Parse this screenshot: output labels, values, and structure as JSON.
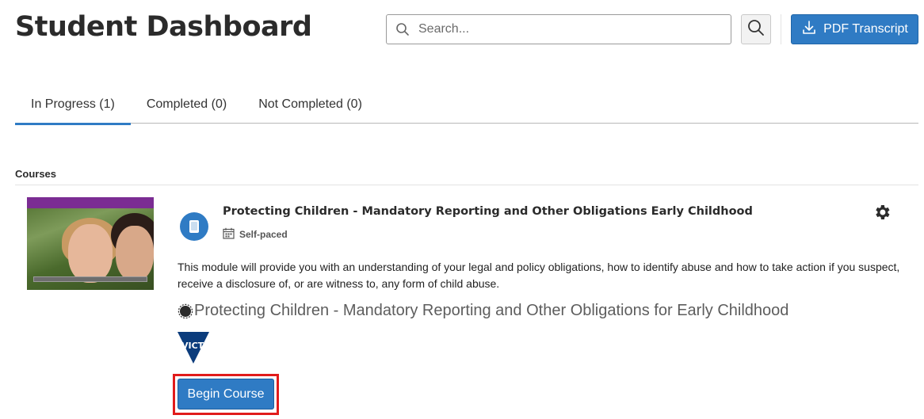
{
  "header": {
    "title": "Student Dashboard",
    "search_placeholder": "Search...",
    "pdf_button_label": "PDF Transcript"
  },
  "tabs": [
    {
      "label": "In Progress (1)",
      "active": true
    },
    {
      "label": "Completed (0)",
      "active": false
    },
    {
      "label": "Not Completed (0)",
      "active": false
    }
  ],
  "courses_section": {
    "label": "Courses",
    "course": {
      "title": "Protecting Children - Mandatory Reporting and Other Obligations Early Childhood",
      "pace": "Self-paced",
      "description": "This module will provide you with an understanding of your legal and policy obligations, how to identify abuse and how to take action if you suspect, receive a disclosure of, or are witness to, any form of child abuse.",
      "subtitle": "Protecting Children - Mandatory Reporting and Other Obligations for Early Childhood",
      "logo_text": "VICTORIA",
      "begin_button_label": "Begin Course"
    }
  },
  "colors": {
    "accent": "#2f7bc4",
    "thumb_bar": "#7b2c93",
    "highlight": "#e11b1b"
  }
}
